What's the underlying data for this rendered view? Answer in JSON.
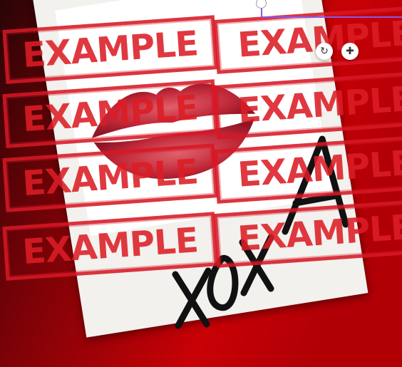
{
  "canvas": {
    "background_colors": [
      "#2a0406",
      "#7d0207",
      "#c80106",
      "#b00006"
    ],
    "card_color": "#f2f1ed"
  },
  "watermark": {
    "text": "EXAMPLE",
    "color": "#e0202a",
    "count": 8
  },
  "selection": {
    "frame_color": "#8a58e6",
    "rotate_icon": "rotate-icon",
    "move_icon": "move-icon"
  },
  "images": {
    "lips": "lips-kiss-image",
    "signature": "xoxo-handwritten-signature"
  }
}
